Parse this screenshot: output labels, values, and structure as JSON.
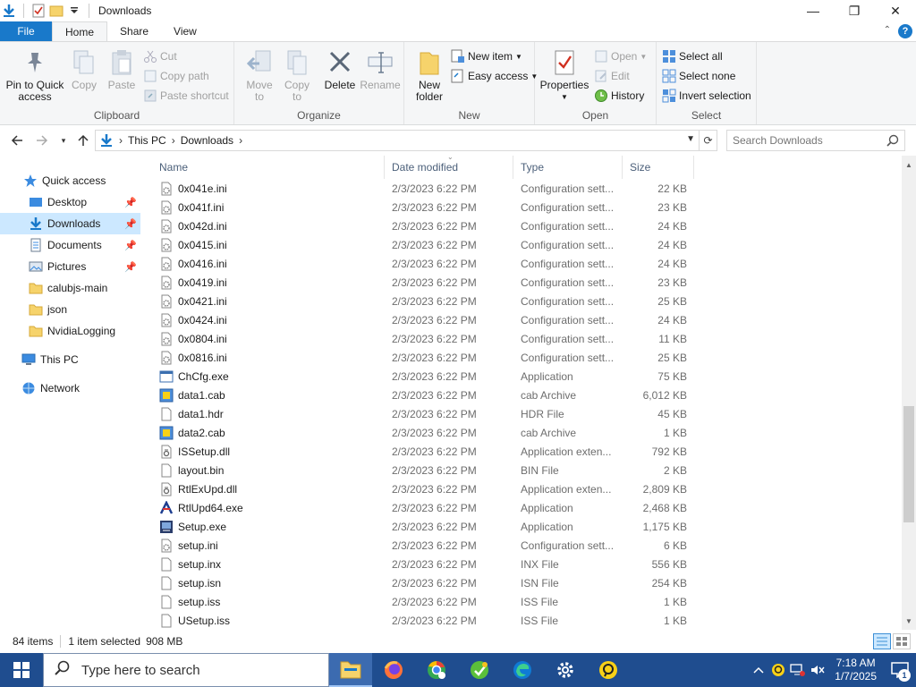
{
  "window": {
    "title": "Downloads",
    "controls": {
      "minimize": "—",
      "maximize": "❐",
      "close": "✕"
    }
  },
  "ribbon_tabs": [
    {
      "label": "File"
    },
    {
      "label": "Home"
    },
    {
      "label": "Share"
    },
    {
      "label": "View"
    }
  ],
  "ribbon": {
    "clipboard": {
      "label": "Clipboard",
      "pin": "Pin to Quick access",
      "copy": "Copy",
      "paste": "Paste",
      "cut": "Cut",
      "copy_path": "Copy path",
      "paste_shortcut": "Paste shortcut"
    },
    "organize": {
      "label": "Organize",
      "move_to": "Move to",
      "copy_to": "Copy to",
      "delete": "Delete",
      "rename": "Rename"
    },
    "new": {
      "label": "New",
      "new_folder": "New folder",
      "new_item": "New item",
      "easy_access": "Easy access"
    },
    "open": {
      "label": "Open",
      "properties": "Properties",
      "open": "Open",
      "edit": "Edit",
      "history": "History"
    },
    "select": {
      "label": "Select",
      "select_all": "Select all",
      "select_none": "Select none",
      "invert": "Invert selection"
    }
  },
  "address": {
    "crumbs": [
      "This PC",
      "Downloads"
    ],
    "search_placeholder": "Search Downloads"
  },
  "nav": [
    {
      "label": "Quick access",
      "icon": "star-icon",
      "pinned": false,
      "selected": false
    },
    {
      "label": "Desktop",
      "icon": "desktop-folder-icon",
      "pinned": true,
      "selected": false
    },
    {
      "label": "Downloads",
      "icon": "downloads-folder-icon",
      "pinned": true,
      "selected": true
    },
    {
      "label": "Documents",
      "icon": "documents-folder-icon",
      "pinned": true,
      "selected": false
    },
    {
      "label": "Pictures",
      "icon": "pictures-folder-icon",
      "pinned": true,
      "selected": false
    },
    {
      "label": "calubjs-main",
      "icon": "folder-icon",
      "pinned": false,
      "selected": false
    },
    {
      "label": "json",
      "icon": "folder-icon",
      "pinned": false,
      "selected": false
    },
    {
      "label": "NvidiaLogging",
      "icon": "folder-icon",
      "pinned": false,
      "selected": false
    },
    {
      "label": "This PC",
      "icon": "computer-icon",
      "pinned": false,
      "selected": false
    },
    {
      "label": "Network",
      "icon": "network-icon",
      "pinned": false,
      "selected": false
    }
  ],
  "columns": {
    "name": "Name",
    "date": "Date modified",
    "type": "Type",
    "size": "Size"
  },
  "files": [
    {
      "name": "0x041e.ini",
      "date": "2/3/2023 6:22 PM",
      "type": "Configuration sett...",
      "size": "22 KB",
      "icon": "ini-file-icon"
    },
    {
      "name": "0x041f.ini",
      "date": "2/3/2023 6:22 PM",
      "type": "Configuration sett...",
      "size": "23 KB",
      "icon": "ini-file-icon"
    },
    {
      "name": "0x042d.ini",
      "date": "2/3/2023 6:22 PM",
      "type": "Configuration sett...",
      "size": "24 KB",
      "icon": "ini-file-icon"
    },
    {
      "name": "0x0415.ini",
      "date": "2/3/2023 6:22 PM",
      "type": "Configuration sett...",
      "size": "24 KB",
      "icon": "ini-file-icon"
    },
    {
      "name": "0x0416.ini",
      "date": "2/3/2023 6:22 PM",
      "type": "Configuration sett...",
      "size": "24 KB",
      "icon": "ini-file-icon"
    },
    {
      "name": "0x0419.ini",
      "date": "2/3/2023 6:22 PM",
      "type": "Configuration sett...",
      "size": "23 KB",
      "icon": "ini-file-icon"
    },
    {
      "name": "0x0421.ini",
      "date": "2/3/2023 6:22 PM",
      "type": "Configuration sett...",
      "size": "25 KB",
      "icon": "ini-file-icon"
    },
    {
      "name": "0x0424.ini",
      "date": "2/3/2023 6:22 PM",
      "type": "Configuration sett...",
      "size": "24 KB",
      "icon": "ini-file-icon"
    },
    {
      "name": "0x0804.ini",
      "date": "2/3/2023 6:22 PM",
      "type": "Configuration sett...",
      "size": "11 KB",
      "icon": "ini-file-icon"
    },
    {
      "name": "0x0816.ini",
      "date": "2/3/2023 6:22 PM",
      "type": "Configuration sett...",
      "size": "25 KB",
      "icon": "ini-file-icon"
    },
    {
      "name": "ChCfg.exe",
      "date": "2/3/2023 6:22 PM",
      "type": "Application",
      "size": "75 KB",
      "icon": "exe-file-icon"
    },
    {
      "name": "data1.cab",
      "date": "2/3/2023 6:22 PM",
      "type": "cab Archive",
      "size": "6,012 KB",
      "icon": "cab-file-icon"
    },
    {
      "name": "data1.hdr",
      "date": "2/3/2023 6:22 PM",
      "type": "HDR File",
      "size": "45 KB",
      "icon": "blank-file-icon"
    },
    {
      "name": "data2.cab",
      "date": "2/3/2023 6:22 PM",
      "type": "cab Archive",
      "size": "1 KB",
      "icon": "cab-file-icon"
    },
    {
      "name": "ISSetup.dll",
      "date": "2/3/2023 6:22 PM",
      "type": "Application exten...",
      "size": "792 KB",
      "icon": "dll-file-icon"
    },
    {
      "name": "layout.bin",
      "date": "2/3/2023 6:22 PM",
      "type": "BIN File",
      "size": "2 KB",
      "icon": "blank-file-icon"
    },
    {
      "name": "RtlExUpd.dll",
      "date": "2/3/2023 6:22 PM",
      "type": "Application exten...",
      "size": "2,809 KB",
      "icon": "dll-file-icon"
    },
    {
      "name": "RtlUpd64.exe",
      "date": "2/3/2023 6:22 PM",
      "type": "Application",
      "size": "2,468 KB",
      "icon": "realtek-exe-icon"
    },
    {
      "name": "Setup.exe",
      "date": "2/3/2023 6:22 PM",
      "type": "Application",
      "size": "1,175 KB",
      "icon": "setup-exe-icon"
    },
    {
      "name": "setup.ini",
      "date": "2/3/2023 6:22 PM",
      "type": "Configuration sett...",
      "size": "6 KB",
      "icon": "ini-file-icon"
    },
    {
      "name": "setup.inx",
      "date": "2/3/2023 6:22 PM",
      "type": "INX File",
      "size": "556 KB",
      "icon": "blank-file-icon"
    },
    {
      "name": "setup.isn",
      "date": "2/3/2023 6:22 PM",
      "type": "ISN File",
      "size": "254 KB",
      "icon": "blank-file-icon"
    },
    {
      "name": "setup.iss",
      "date": "2/3/2023 6:22 PM",
      "type": "ISS File",
      "size": "1 KB",
      "icon": "blank-file-icon"
    },
    {
      "name": "USetup.iss",
      "date": "2/3/2023 6:22 PM",
      "type": "ISS File",
      "size": "1 KB",
      "icon": "blank-file-icon"
    }
  ],
  "status": {
    "items": "84 items",
    "selected": "1 item selected",
    "selected_size": "908 MB"
  },
  "taskbar": {
    "search_placeholder": "Type here to search",
    "apps": [
      {
        "name": "file-explorer-icon",
        "active": true
      },
      {
        "name": "firefox-icon",
        "active": false
      },
      {
        "name": "chrome-profile-icon",
        "active": false
      },
      {
        "name": "app-green-icon",
        "active": false
      },
      {
        "name": "edge-icon",
        "active": false
      },
      {
        "name": "settings-gear-icon",
        "active": false
      },
      {
        "name": "yellow-app-icon",
        "active": false
      }
    ],
    "time": "7:18 AM",
    "date": "1/7/2025",
    "notification_count": "1"
  },
  "colors": {
    "accent": "#1979ca",
    "selection": "#cce8ff",
    "taskbar": "#1f4d8f",
    "folder_yellow": "#f6d36b"
  }
}
